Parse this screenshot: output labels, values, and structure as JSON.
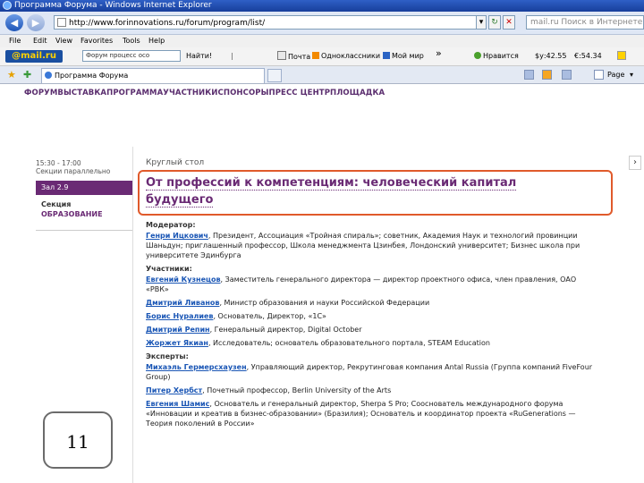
{
  "window": {
    "title": "Программа Форума - Windows Internet Explorer"
  },
  "address": {
    "url": "http://www.forinnovations.ru/forum/program/list/",
    "search_placeholder": "mail.ru Поиск в Интернете"
  },
  "menu": [
    "File",
    "Edit",
    "View",
    "Favorites",
    "Tools",
    "Help"
  ],
  "mailbar": {
    "logo": "@mail.ru",
    "search_value": "Форум процесс осо",
    "find_label": "Найти!",
    "items": [
      "Почта",
      "Одноклассники",
      "Мой мир"
    ],
    "more": "»",
    "weather_label": "Нравится",
    "rates": [
      "$у:42.55",
      "€:54.34"
    ]
  },
  "tab": {
    "label": "Программа Форума"
  },
  "command": {
    "page_label": "Page"
  },
  "content": {
    "nav_menu": "ФОРУМВЫСТАВКАПРОГРАММАУЧАСТНИКИСПОНСОРЫПРЕСС ЦЕНТРПЛОЩАДКА",
    "side": {
      "time": "15:30 - 17:00",
      "parallel": "Секции параллельно",
      "hall": "Зал 2.9",
      "section_label": "Секция",
      "section_name": "ОБРАЗОВАНИЕ"
    },
    "round_table_label": "Круглый стол",
    "session_title": "От профессий к компетенциям: человеческий капитал будущего",
    "moderator_label": "Модератор:",
    "moderator": {
      "name": "Генри Ицкович",
      "desc": ", Президент, Ассоциация «Тройная спираль»; советник, Академия Наук и технологий провинции Шаньдун; приглашенный профессор, Школа менеджмента Цзинбея, Лондонский университет; Бизнес школа при университете Эдинбурга"
    },
    "participants_label": "Участники:",
    "participants": [
      {
        "name": "Евгений Кузнецов",
        "desc": ", Заместитель генерального директора — директор проектного офиса, член правления, ОАО «РВК»"
      },
      {
        "name": "Дмитрий Ливанов",
        "desc": ", Министр образования и науки Российской Федерации"
      },
      {
        "name": "Борис Нуралиев",
        "desc": ", Основатель, Директор, «1С»"
      },
      {
        "name": "Дмитрий Репин",
        "desc": ", Генеральный директор, Digital October"
      },
      {
        "name": "Жоржет Якиан",
        "desc": ", Исследователь; основатель образовательного портала, STEAM Education"
      }
    ],
    "experts_label": "Эксперты:",
    "experts": [
      {
        "name": "Михаэль Гермерсхаузен",
        "desc": ", Управляющий директор, Рекрутинговая компания Antal Russia (Группа компаний FiveFour Group)"
      },
      {
        "name": "Питер Хербст",
        "desc": ", Почетный профессор, Berlin University of the Arts"
      },
      {
        "name": "Евгения Шамис",
        "desc": ", Основатель и генеральный директор, Sherpa S Pro; Сооснователь международного форума «Инновации и креатив в бизнес-образовании» (Бразилия); Основатель и координатор проекта «RuGenerations — Теория поколений в России»"
      }
    ]
  },
  "page_number": "11"
}
